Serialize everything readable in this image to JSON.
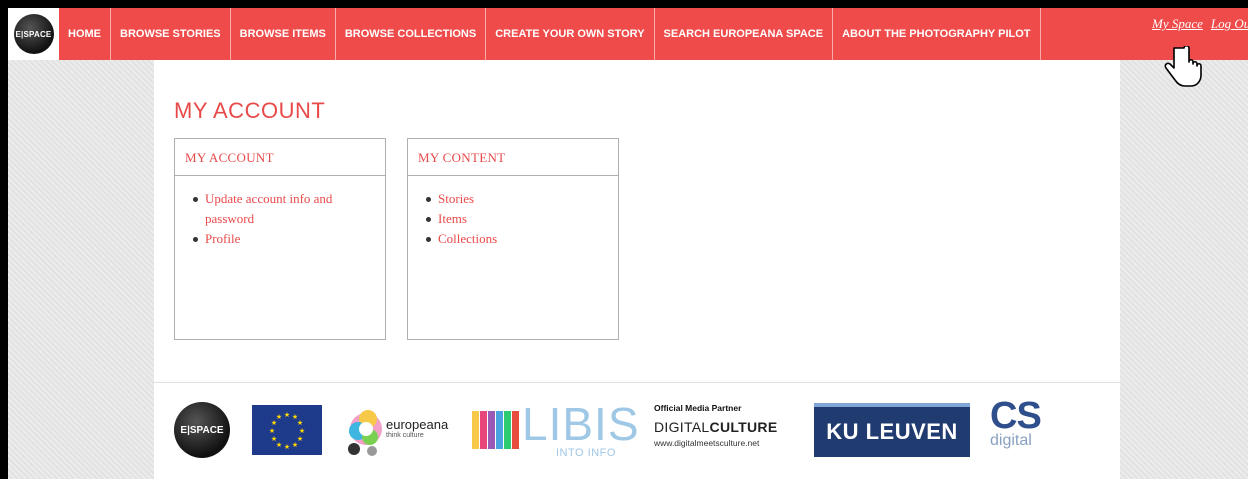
{
  "nav": {
    "logo_text": "E|SPACE",
    "items": [
      {
        "label": "HOME"
      },
      {
        "label": "BROWSE STORIES"
      },
      {
        "label": "BROWSE ITEMS"
      },
      {
        "label": "BROWSE COLLECTIONS"
      },
      {
        "label": "CREATE YOUR OWN STORY"
      },
      {
        "label": "SEARCH EUROPEANA SPACE"
      },
      {
        "label": "ABOUT THE PHOTOGRAPHY PILOT"
      }
    ],
    "my_space": "My Space",
    "log_out": "Log Ou"
  },
  "page": {
    "title": "MY ACCOUNT"
  },
  "panels": {
    "account": {
      "title": "MY ACCOUNT",
      "links": [
        "Update account info and password",
        "Profile"
      ]
    },
    "content": {
      "title": "MY CONTENT",
      "links": [
        "Stories",
        "Items",
        "Collections"
      ]
    }
  },
  "footer": {
    "espace_logo_text": "E|SPACE",
    "europeana": {
      "name": "europeana",
      "tagline": "think culture"
    },
    "libis": {
      "name": "LIBIS",
      "sub": "INTO INFO"
    },
    "digital_culture": {
      "partner": "Official Media Partner",
      "name_light": "DIGITAL",
      "name_bold": "CULTURE",
      "url": "www.digitalmeetsculture.net"
    },
    "ku_leuven": "KU LEUVEN",
    "cs_digital": {
      "big": "CS",
      "small": "digital"
    }
  },
  "colors": {
    "accent": "#f04b4b",
    "link": "#e84a4a",
    "background": "#e6e6e6"
  }
}
